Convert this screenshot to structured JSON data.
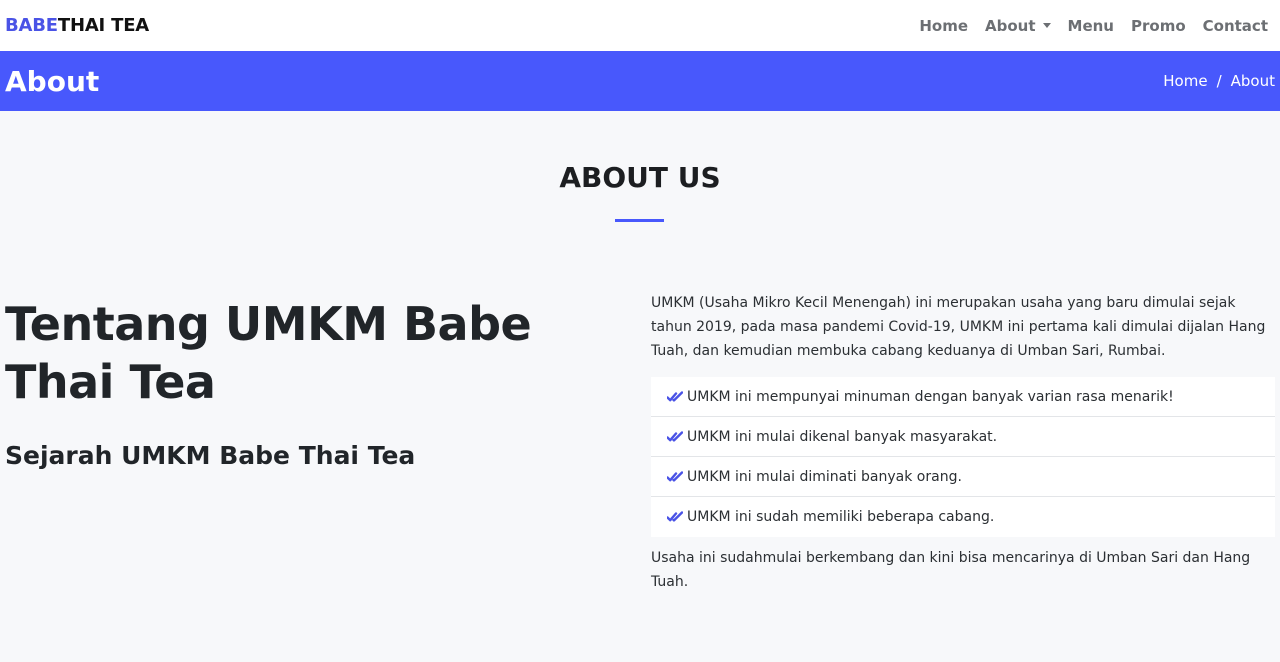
{
  "brand": {
    "part1": "BABE",
    "part2": "THAI TEA"
  },
  "nav": {
    "home": "Home",
    "about": "About",
    "menu": "Menu",
    "promo": "Promo",
    "contact": "Contact"
  },
  "banner": {
    "title": "About",
    "breadcrumb_home": "Home",
    "breadcrumb_sep": "/",
    "breadcrumb_current": "About"
  },
  "section": {
    "title": "ABOUT US"
  },
  "left": {
    "heading": "Tentang UMKM Babe Thai Tea",
    "subheading": "Sejarah UMKM Babe Thai Tea"
  },
  "right": {
    "paragraph": "UMKM (Usaha Mikro Kecil Menengah) ini merupakan usaha yang baru dimulai sejak tahun 2019, pada masa pandemi Covid-19, UMKM ini pertama kali dimulai dijalan Hang Tuah, dan kemudian membuka cabang keduanya di Umban Sari, Rumbai.",
    "items": [
      "UMKM ini mempunyai minuman dengan banyak varian rasa menarik!",
      "UMKM ini mulai dikenal banyak masyarakat.",
      "UMKM ini mulai diminati banyak orang.",
      "UMKM ini sudah memiliki beberapa cabang."
    ],
    "item_icon": "double-check-icon",
    "paragraph2": "Usaha ini sudahmulai berkembang dan kini bisa mencarinya di Umban Sari dan Hang Tuah."
  },
  "colors": {
    "accent": "#4858fc",
    "brand_accent": "#4a53e6"
  }
}
